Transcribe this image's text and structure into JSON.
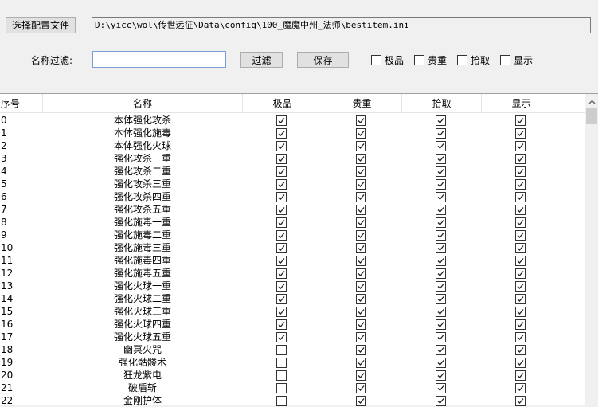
{
  "toolbar": {
    "select_config_label": "选择配置文件",
    "config_path": "D:\\yicc\\wol\\传世远征\\Data\\config\\100_魔魔中州_法师\\bestitem.ini",
    "filter_label": "名称过滤:",
    "filter_value": "",
    "filter_button_label": "过滤",
    "save_button_label": "保存",
    "flags": [
      {
        "label": "极品",
        "checked": false
      },
      {
        "label": "贵重",
        "checked": false
      },
      {
        "label": "拾取",
        "checked": false
      },
      {
        "label": "显示",
        "checked": false
      }
    ]
  },
  "table": {
    "columns": [
      "序号",
      "名称",
      "极品",
      "贵重",
      "拾取",
      "显示"
    ],
    "rows": [
      {
        "idx": "0",
        "name": "本体强化攻杀",
        "flags": [
          true,
          true,
          true,
          true
        ]
      },
      {
        "idx": "1",
        "name": "本体强化施毒",
        "flags": [
          true,
          true,
          true,
          true
        ]
      },
      {
        "idx": "2",
        "name": "本体强化火球",
        "flags": [
          true,
          true,
          true,
          true
        ]
      },
      {
        "idx": "3",
        "name": "强化攻杀一重",
        "flags": [
          true,
          true,
          true,
          true
        ]
      },
      {
        "idx": "4",
        "name": "强化攻杀二重",
        "flags": [
          true,
          true,
          true,
          true
        ]
      },
      {
        "idx": "5",
        "name": "强化攻杀三重",
        "flags": [
          true,
          true,
          true,
          true
        ]
      },
      {
        "idx": "6",
        "name": "强化攻杀四重",
        "flags": [
          true,
          true,
          true,
          true
        ]
      },
      {
        "idx": "7",
        "name": "强化攻杀五重",
        "flags": [
          true,
          true,
          true,
          true
        ]
      },
      {
        "idx": "8",
        "name": "强化施毒一重",
        "flags": [
          true,
          true,
          true,
          true
        ]
      },
      {
        "idx": "9",
        "name": "强化施毒二重",
        "flags": [
          true,
          true,
          true,
          true
        ]
      },
      {
        "idx": "10",
        "name": "强化施毒三重",
        "flags": [
          true,
          true,
          true,
          true
        ]
      },
      {
        "idx": "11",
        "name": "强化施毒四重",
        "flags": [
          true,
          true,
          true,
          true
        ]
      },
      {
        "idx": "12",
        "name": "强化施毒五重",
        "flags": [
          true,
          true,
          true,
          true
        ]
      },
      {
        "idx": "13",
        "name": "强化火球一重",
        "flags": [
          true,
          true,
          true,
          true
        ]
      },
      {
        "idx": "14",
        "name": "强化火球二重",
        "flags": [
          true,
          true,
          true,
          true
        ]
      },
      {
        "idx": "15",
        "name": "强化火球三重",
        "flags": [
          true,
          true,
          true,
          true
        ]
      },
      {
        "idx": "16",
        "name": "强化火球四重",
        "flags": [
          true,
          true,
          true,
          true
        ]
      },
      {
        "idx": "17",
        "name": "强化火球五重",
        "flags": [
          true,
          true,
          true,
          true
        ]
      },
      {
        "idx": "18",
        "name": "幽冥火咒",
        "flags": [
          false,
          true,
          true,
          true
        ]
      },
      {
        "idx": "19",
        "name": "强化骷髅术",
        "flags": [
          false,
          true,
          true,
          true
        ]
      },
      {
        "idx": "20",
        "name": "狂龙紫电",
        "flags": [
          false,
          true,
          true,
          true
        ]
      },
      {
        "idx": "21",
        "name": "破盾斩",
        "flags": [
          false,
          true,
          true,
          true
        ]
      },
      {
        "idx": "22",
        "name": "金刚护体",
        "flags": [
          false,
          true,
          true,
          true
        ]
      }
    ]
  },
  "icons": {
    "scroll_up": "chevron-up-icon",
    "check": "check-icon"
  },
  "colors": {
    "window_bg": "#f0f0f0",
    "grid_bg": "#ffffff",
    "input_border": "#7a9cd3"
  }
}
